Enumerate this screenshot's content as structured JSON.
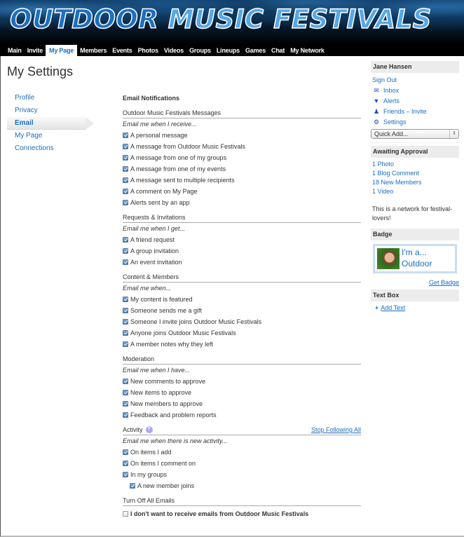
{
  "site": {
    "title_part1": "OUTDOOR",
    "title_part2": "MUSIC FESTIVALS"
  },
  "nav": {
    "items": [
      {
        "label": "Main",
        "active": false
      },
      {
        "label": "Invite",
        "active": false
      },
      {
        "label": "My Page",
        "active": true
      },
      {
        "label": "Members",
        "active": false
      },
      {
        "label": "Events",
        "active": false
      },
      {
        "label": "Photos",
        "active": false
      },
      {
        "label": "Videos",
        "active": false
      },
      {
        "label": "Groups",
        "active": false
      },
      {
        "label": "Lineups",
        "active": false
      },
      {
        "label": "Games",
        "active": false
      },
      {
        "label": "Chat",
        "active": false
      },
      {
        "label": "My Network",
        "active": false
      }
    ]
  },
  "page": {
    "title": "My Settings"
  },
  "side_menu": {
    "items": [
      {
        "label": "Profile",
        "active": false
      },
      {
        "label": "Privacy",
        "active": false
      },
      {
        "label": "Email",
        "active": true
      },
      {
        "label": "My Page",
        "active": false
      },
      {
        "label": "Connections",
        "active": false
      }
    ]
  },
  "email": {
    "heading": "Email Notifications",
    "sections": [
      {
        "title": "Outdoor Music Festivals Messages",
        "intro": "Email me when I receive...",
        "options": [
          {
            "label": "A personal message",
            "checked": true
          },
          {
            "label": "A message from Outdoor Music Festivals",
            "checked": true
          },
          {
            "label": "A message from one of my groups",
            "checked": true
          },
          {
            "label": "A message from one of my events",
            "checked": true
          },
          {
            "label": "A message sent to multiple recipients",
            "checked": true
          },
          {
            "label": "A comment on My Page",
            "checked": true
          },
          {
            "label": "Alerts sent by an app",
            "checked": true
          }
        ]
      },
      {
        "title": "Requests & Invitations",
        "intro": "Email me when I get...",
        "options": [
          {
            "label": "A friend request",
            "checked": true
          },
          {
            "label": "A group invitation",
            "checked": true
          },
          {
            "label": "An event invitation",
            "checked": true
          }
        ]
      },
      {
        "title": "Content & Members",
        "intro": "Email me when...",
        "options": [
          {
            "label": "My content is featured",
            "checked": true
          },
          {
            "label": "Someone sends me a gift",
            "checked": true
          },
          {
            "label": "Someone I invite joins Outdoor Music Festivals",
            "checked": true
          },
          {
            "label": "Anyone joins Outdoor Music Festivals",
            "checked": true
          },
          {
            "label": "A member notes why they left",
            "checked": true
          }
        ]
      },
      {
        "title": "Moderation",
        "intro": "Email me when I have...",
        "options": [
          {
            "label": "New comments to approve",
            "checked": true
          },
          {
            "label": "New items to approve",
            "checked": true
          },
          {
            "label": "New members to approve",
            "checked": true
          },
          {
            "label": "Feedback and problem reports",
            "checked": true
          }
        ]
      },
      {
        "title": "Activity",
        "help": "?",
        "link": "Stop Following All",
        "intro": "Email me when there is new activity...",
        "options": [
          {
            "label": "On items I add",
            "checked": true
          },
          {
            "label": "On items I comment on",
            "checked": true
          },
          {
            "label": "In my groups",
            "checked": true
          },
          {
            "label": "A new member joins",
            "checked": true,
            "indent": true
          }
        ]
      },
      {
        "title": "Turn Off All Emails",
        "options": [
          {
            "label": "I don't want to receive emails from Outdoor Music Festivals",
            "checked": false,
            "bold": true
          }
        ]
      }
    ]
  },
  "user_box": {
    "name": "Jane Hansen",
    "sign_out": "Sign Out",
    "links": [
      {
        "label": "Inbox",
        "icon": "envelope-icon",
        "glyph": "✉"
      },
      {
        "label": "Alerts",
        "icon": "megaphone-icon",
        "glyph": "▼"
      },
      {
        "label": "Friends – Invite",
        "icon": "person-icon",
        "glyph": "♟"
      },
      {
        "label": "Settings",
        "icon": "gear-icon",
        "glyph": "⚙"
      }
    ],
    "quick_add": "Quick Add...",
    "quick_add_arrows": "⇕"
  },
  "approval": {
    "title": "Awaiting Approval",
    "items": [
      "1 Photo",
      "1 Blog Comment",
      "18 New Members",
      "1 Video"
    ],
    "description": "This is a network for festival-lovers!"
  },
  "badge": {
    "title": "Badge",
    "text": "I'm a... Outdoor Music",
    "get_badge": "Get Badge"
  },
  "text_box": {
    "title": "Text Box",
    "plus": "+",
    "add_text": "Add Text"
  },
  "colors": {
    "link": "#1a6fc0",
    "nav_bg": "#000000",
    "box_head_bg": "#ececec"
  }
}
